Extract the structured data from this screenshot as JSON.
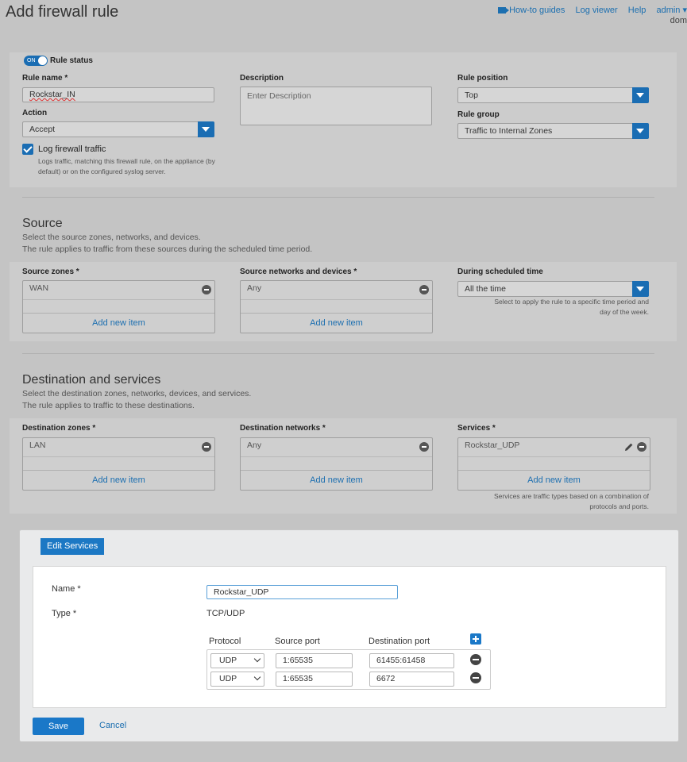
{
  "header": {
    "title": "Add firewall rule",
    "nav": {
      "howto": "How-to guides",
      "logviewer": "Log viewer",
      "help": "Help",
      "user": "admin",
      "domain": "dom"
    }
  },
  "rule": {
    "status_label": "Rule status",
    "toggle_text": "ON",
    "name_label": "Rule name *",
    "name_value": "Rockstar_IN",
    "description_label": "Description",
    "description_placeholder": "Enter Description",
    "position_label": "Rule position",
    "position_value": "Top",
    "action_label": "Action",
    "action_value": "Accept",
    "group_label": "Rule group",
    "group_value": "Traffic to Internal Zones",
    "log_label": "Log firewall traffic",
    "log_hint_1": "Logs traffic, matching this firewall rule, on the appliance (by",
    "log_hint_2": "default) or on the configured syslog server."
  },
  "source": {
    "title": "Source",
    "desc_1": "Select the source zones, networks, and devices.",
    "desc_2": "The rule applies to traffic from these sources during the scheduled time period.",
    "zones_label": "Source zones *",
    "zones_value": "WAN",
    "networks_label": "Source networks and devices *",
    "networks_value": "Any",
    "schedule_label": "During scheduled time",
    "schedule_value": "All the time",
    "schedule_hint_1": "Select to apply the rule to a specific time period and",
    "schedule_hint_2": "day of the week.",
    "add_new": "Add new item"
  },
  "destination": {
    "title": "Destination and services",
    "desc_1": "Select the destination zones, networks, devices, and services.",
    "desc_2": "The rule applies to traffic to these destinations.",
    "zones_label": "Destination zones *",
    "zones_value": "LAN",
    "networks_label": "Destination networks *",
    "networks_value": "Any",
    "services_label": "Services *",
    "services_value": "Rockstar_UDP",
    "services_hint_1": "Services are traffic types based on a combination of",
    "services_hint_2": "protocols and ports.",
    "add_new": "Add new item"
  },
  "modal": {
    "tab": "Edit Services",
    "name_label": "Name *",
    "name_value": "Rockstar_UDP",
    "type_label": "Type *",
    "type_value": "TCP/UDP",
    "col_protocol": "Protocol",
    "col_source": "Source port",
    "col_dest": "Destination port",
    "rows": [
      {
        "protocol": "UDP",
        "source": "1:65535",
        "dest": "61455:61458"
      },
      {
        "protocol": "UDP",
        "source": "1:65535",
        "dest": "6672"
      }
    ],
    "save": "Save",
    "cancel": "Cancel"
  }
}
